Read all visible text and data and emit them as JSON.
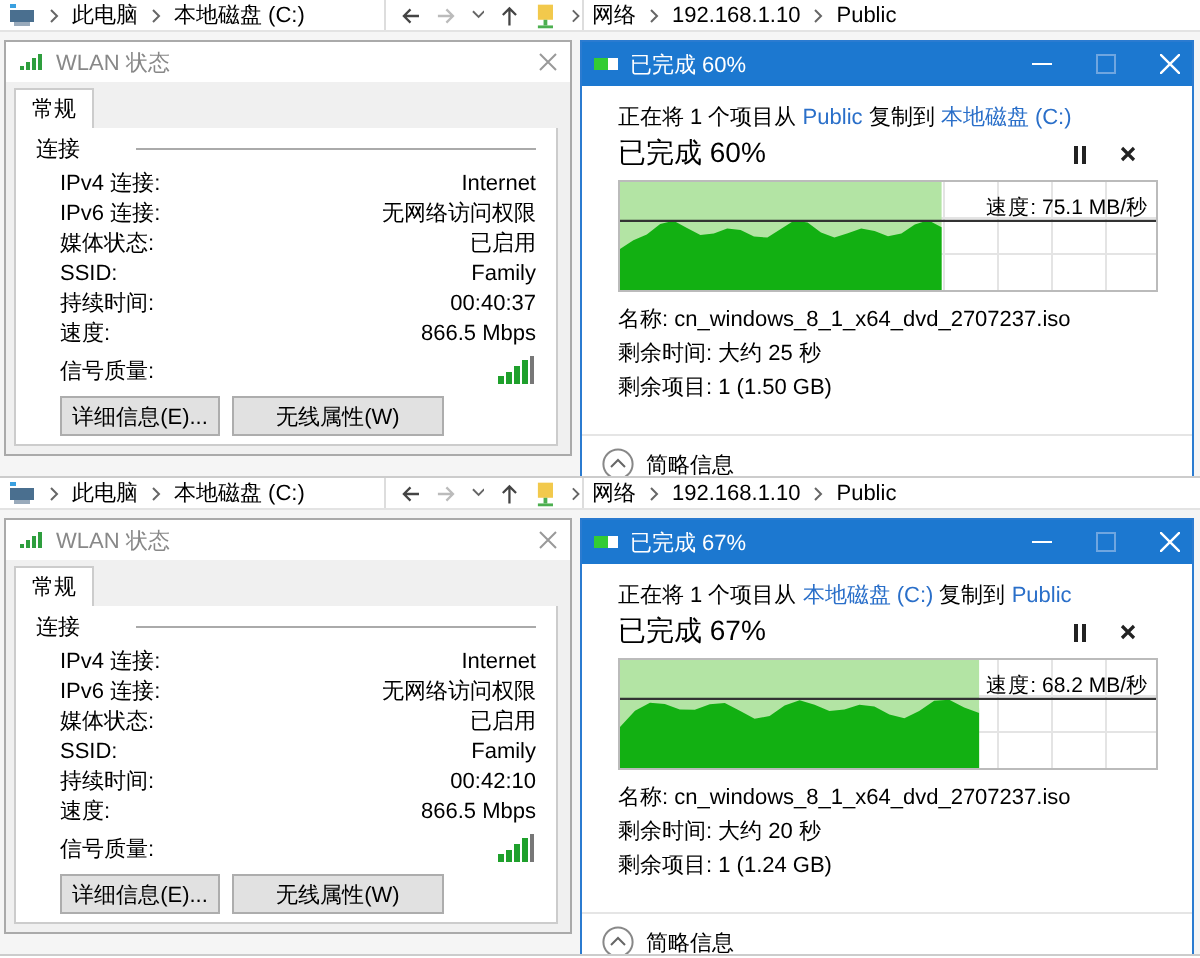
{
  "panels": [
    {
      "explorer": {
        "left_path": [
          "此电脑",
          "本地磁盘 (C:)"
        ],
        "right_path": [
          "网络",
          "192.168.1.10",
          "Public"
        ]
      },
      "wlan": {
        "title": "WLAN 状态",
        "tabs": [
          {
            "label": "常规",
            "selected": true
          }
        ],
        "group": "连接",
        "rows": [
          {
            "label": "IPv4 连接:",
            "value": "Internet"
          },
          {
            "label": "IPv6 连接:",
            "value": "无网络访问权限"
          },
          {
            "label": "媒体状态:",
            "value": "已启用"
          },
          {
            "label": "SSID:",
            "value": "Family"
          },
          {
            "label": "持续时间:",
            "value": "00:40:37"
          },
          {
            "label": "速度:",
            "value": "866.5 Mbps"
          }
        ],
        "signal_label": "信号质量:",
        "buttons": [
          "详细信息(E)...",
          "无线属性(W)"
        ]
      },
      "copy": {
        "title": "已完成 60%",
        "message": [
          {
            "kind": "text",
            "text": "正在将 1 个项目从 "
          },
          {
            "kind": "link",
            "text": "Public"
          },
          {
            "kind": "text",
            "text": " 复制到 "
          },
          {
            "kind": "link",
            "text": "本地磁盘 (C:)"
          }
        ],
        "progress_text": "已完成 60%",
        "level": 0.6,
        "speed": "速度: 75.1 MB/秒",
        "details": [
          "名称: cn_windows_8_1_x64_dvd_2707237.iso",
          "剩余时间: 大约 25 秒",
          "剩余项目: 1 (1.50 GB)"
        ],
        "more_button": "简略信息"
      }
    },
    {
      "explorer": {
        "left_path": [
          "此电脑",
          "本地磁盘 (C:)"
        ],
        "right_path": [
          "网络",
          "192.168.1.10",
          "Public"
        ]
      },
      "wlan": {
        "title": "WLAN 状态",
        "tabs": [
          {
            "label": "常规",
            "selected": true
          }
        ],
        "group": "连接",
        "rows": [
          {
            "label": "IPv4 连接:",
            "value": "Internet"
          },
          {
            "label": "IPv6 连接:",
            "value": "无网络访问权限"
          },
          {
            "label": "媒体状态:",
            "value": "已启用"
          },
          {
            "label": "SSID:",
            "value": "Family"
          },
          {
            "label": "持续时间:",
            "value": "00:42:10"
          },
          {
            "label": "速度:",
            "value": "866.5 Mbps"
          }
        ],
        "signal_label": "信号质量:",
        "buttons": [
          "详细信息(E)...",
          "无线属性(W)"
        ]
      },
      "copy": {
        "title": "已完成 67%",
        "message": [
          {
            "kind": "text",
            "text": "正在将 1 个项目从 "
          },
          {
            "kind": "link",
            "text": "本地磁盘 (C:)"
          },
          {
            "kind": "text",
            "text": " 复制到 "
          },
          {
            "kind": "link",
            "text": "Public"
          }
        ],
        "progress_text": "已完成 67%",
        "level": 0.67,
        "speed": "速度: 68.2 MB/秒",
        "details": [
          "名称: cn_windows_8_1_x64_dvd_2707237.iso",
          "剩余时间: 大约 20 秒",
          "剩余项目: 1 (1.24 GB)"
        ],
        "more_button": "简略信息"
      }
    }
  ]
}
